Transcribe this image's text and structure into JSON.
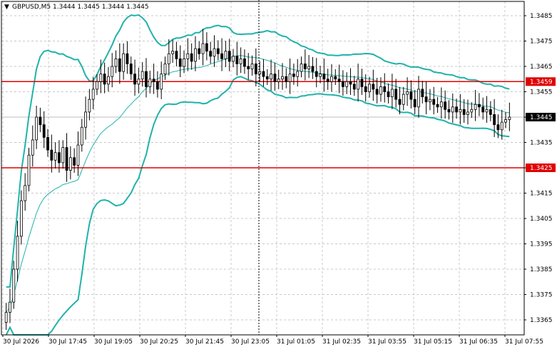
{
  "header": {
    "arrow_glyph": "▼",
    "symbol_text": "GBPUSD,M5  1.3444 1.3445 1.3444 1.3445"
  },
  "chart_data": {
    "type": "candlestick",
    "symbol": "GBPUSD",
    "timeframe": "M5",
    "ohlc_current": {
      "open": 1.3444,
      "high": 1.3445,
      "low": 1.3444,
      "close": 1.3445
    },
    "y_ticks": [
      "1.3485",
      "1.3475",
      "1.3465",
      "1.3455",
      "1.3445",
      "1.3435",
      "1.3425",
      "1.3415",
      "1.3405",
      "1.3395",
      "1.3385",
      "1.3375",
      "1.3365"
    ],
    "ylim": [
      1.3361,
      1.3492
    ],
    "x_ticks": [
      "30 Jul 2026",
      "30 Jul 17:45",
      "30 Jul 19:05",
      "30 Jul 20:25",
      "30 Jul 21:45",
      "30 Jul 23:05",
      "31 Jul 01:05",
      "31 Jul 02:35",
      "31 Jul 03:55",
      "31 Jul 05:15",
      "31 Jul 06:35",
      "31 Jul 07:55"
    ],
    "current_price_label": "1.3445",
    "horizontal_levels": [
      {
        "price": 1.3459,
        "label": "1.3459",
        "color": "#e00000"
      },
      {
        "price": 1.3425,
        "label": "1.3425",
        "color": "#e00000"
      }
    ],
    "crosshair_vertical_at": "30 Jul 23:05",
    "grid": true,
    "colors": {
      "bollinger": "#20b2aa",
      "level": "#e00000",
      "candle": "#000000",
      "grid": "#c8c8c8"
    },
    "candles_close": [
      1.3368,
      1.3372,
      1.3385,
      1.3398,
      1.3412,
      1.3418,
      1.343,
      1.3436,
      1.3445,
      1.3442,
      1.3437,
      1.3432,
      1.3428,
      1.3431,
      1.3427,
      1.3433,
      1.3424,
      1.3429,
      1.3426,
      1.3434,
      1.3441,
      1.3447,
      1.3452,
      1.3456,
      1.3459,
      1.3462,
      1.3458,
      1.3461,
      1.3465,
      1.3468,
      1.3463,
      1.347,
      1.3466,
      1.3462,
      1.3458,
      1.346,
      1.3463,
      1.3457,
      1.346,
      1.3459,
      1.3456,
      1.3462,
      1.3466,
      1.347,
      1.3471,
      1.3468,
      1.3465,
      1.3468,
      1.347,
      1.3467,
      1.3472,
      1.347,
      1.3474,
      1.3471,
      1.3469,
      1.3472,
      1.347,
      1.3468,
      1.3471,
      1.3467,
      1.3469,
      1.3466,
      1.3468,
      1.3465,
      1.3464,
      1.3466,
      1.3462,
      1.3463,
      1.3461,
      1.346,
      1.3462,
      1.3459,
      1.346,
      1.3461,
      1.3459,
      1.3462,
      1.3461,
      1.3463,
      1.3466,
      1.3464,
      1.3465,
      1.3463,
      1.3461,
      1.3462,
      1.346,
      1.3459,
      1.3461,
      1.346,
      1.3459,
      1.3457,
      1.3459,
      1.3458,
      1.3456,
      1.346,
      1.3457,
      1.3455,
      1.3458,
      1.3456,
      1.3454,
      1.3457,
      1.3455,
      1.3453,
      1.3456,
      1.3452,
      1.345,
      1.3454,
      1.3455,
      1.3452,
      1.3449,
      1.3456,
      1.3453,
      1.3451,
      1.3452,
      1.345,
      1.3449,
      1.3451,
      1.3448,
      1.3447,
      1.3449,
      1.3447,
      1.3448,
      1.3446,
      1.3447,
      1.3448,
      1.345,
      1.3449,
      1.3447,
      1.3448,
      1.3446,
      1.3442,
      1.344,
      1.3443,
      1.3444,
      1.3445
    ]
  }
}
